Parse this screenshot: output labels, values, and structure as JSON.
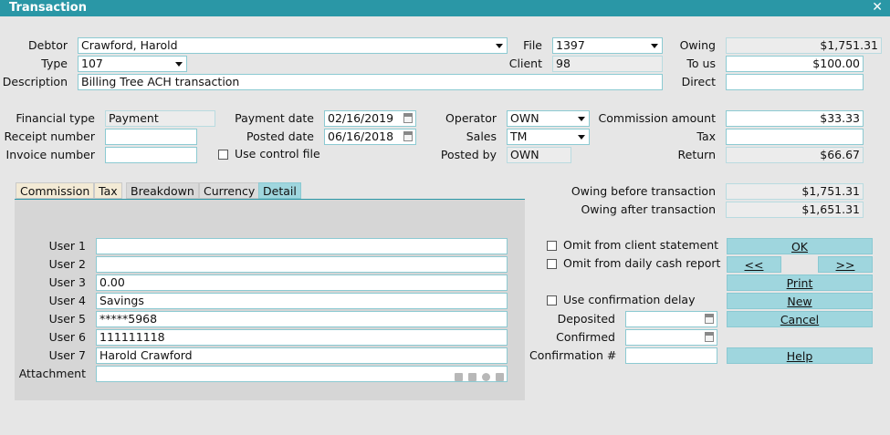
{
  "window": {
    "title": "Transaction",
    "close": "✕"
  },
  "top": {
    "debtor_label": "Debtor",
    "debtor_value": "Crawford, Harold",
    "type_label": "Type",
    "type_value": "107",
    "description_label": "Description",
    "description_value": "Billing Tree ACH transaction",
    "file_label": "File",
    "file_value": "1397",
    "client_label": "Client",
    "client_value": "98",
    "owing_label": "Owing",
    "owing_value": "$1,751.31",
    "to_us_label": "To us",
    "to_us_value": "$100.00",
    "direct_label": "Direct",
    "direct_value": ""
  },
  "mid": {
    "financial_type_label": "Financial type",
    "financial_type_value": "Payment",
    "receipt_number_label": "Receipt number",
    "receipt_number_value": "",
    "invoice_number_label": "Invoice number",
    "invoice_number_value": "",
    "payment_date_label": "Payment date",
    "payment_date_value": "02/16/2019",
    "posted_date_label": "Posted date",
    "posted_date_value": "06/16/2018",
    "use_control_file_label": "Use control file",
    "operator_label": "Operator",
    "operator_value": "OWN",
    "sales_label": "Sales",
    "sales_value": "TM",
    "posted_by_label": "Posted by",
    "posted_by_value": "OWN",
    "commission_amount_label": "Commission amount",
    "commission_amount_value": "$33.33",
    "tax_label": "Tax",
    "tax_value": "",
    "return_label": "Return",
    "return_value": "$66.67"
  },
  "tabs": [
    "Commission",
    "Tax",
    "Breakdown",
    "Currency",
    "Detail"
  ],
  "detail": {
    "user1_label": "User 1",
    "user1_value": "",
    "user2_label": "User 2",
    "user2_value": "",
    "user3_label": "User 3",
    "user3_value": "0.00",
    "user4_label": "User 4",
    "user4_value": "Savings",
    "user5_label": "User 5",
    "user5_value": "*****5968",
    "user6_label": "User 6",
    "user6_value": "111111118",
    "user7_label": "User 7",
    "user7_value": "Harold Crawford",
    "attachment_label": "Attachment",
    "attachment_value": ""
  },
  "summary": {
    "owing_before_label": "Owing before transaction",
    "owing_before_value": "$1,751.31",
    "owing_after_label": "Owing after transaction",
    "owing_after_value": "$1,651.31"
  },
  "options": {
    "omit_client_statement": "Omit from client statement",
    "omit_daily_cash": "Omit from daily cash report",
    "use_confirmation_delay": "Use confirmation delay",
    "deposited_label": "Deposited",
    "deposited_value": "",
    "confirmed_label": "Confirmed",
    "confirmed_value": "",
    "confirmation_no_label": "Confirmation #",
    "confirmation_no_value": ""
  },
  "buttons": {
    "ok": "OK",
    "prev": "<<",
    "next": ">>",
    "print": "Print",
    "new": "New",
    "cancel": "Cancel",
    "help": "Help"
  },
  "colors": {
    "accent": "#2a97a6",
    "button": "#9fd6de"
  }
}
